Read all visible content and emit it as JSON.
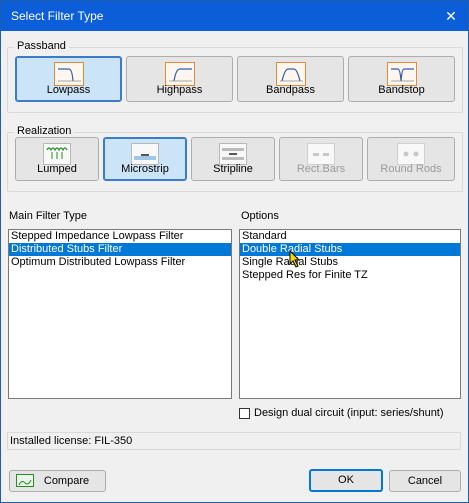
{
  "window": {
    "title": "Select Filter Type",
    "close_glyph": "✕"
  },
  "passband": {
    "label": "Passband",
    "buttons": [
      {
        "label": "Lowpass",
        "icon": "lowpass-response-icon",
        "selected": true
      },
      {
        "label": "Highpass",
        "icon": "highpass-response-icon",
        "selected": false
      },
      {
        "label": "Bandpass",
        "icon": "bandpass-response-icon",
        "selected": false
      },
      {
        "label": "Bandstop",
        "icon": "bandstop-response-icon",
        "selected": false
      }
    ]
  },
  "realization": {
    "label": "Realization",
    "buttons": [
      {
        "label": "Lumped",
        "icon": "lumped-icon",
        "selected": false,
        "enabled": true
      },
      {
        "label": "Microstrip",
        "icon": "microstrip-icon",
        "selected": true,
        "enabled": true
      },
      {
        "label": "Stripline",
        "icon": "stripline-icon",
        "selected": false,
        "enabled": true
      },
      {
        "label": "Rect.Bars",
        "icon": "rect-bars-icon",
        "selected": false,
        "enabled": false
      },
      {
        "label": "Round Rods",
        "icon": "round-rods-icon",
        "selected": false,
        "enabled": false
      }
    ]
  },
  "main_filter_type": {
    "label": "Main Filter Type",
    "items": [
      {
        "text": "Stepped Impedance Lowpass Filter",
        "selected": false
      },
      {
        "text": "Distributed Stubs Filter",
        "selected": true
      },
      {
        "text": "Optimum Distributed Lowpass Filter",
        "selected": false
      }
    ]
  },
  "options": {
    "label": "Options",
    "items": [
      {
        "text": "Standard",
        "selected": false
      },
      {
        "text": "Double Radial Stubs",
        "selected": true
      },
      {
        "text": "Single Radial Stubs",
        "selected": false
      },
      {
        "text": "Stepped Res for Finite TZ",
        "selected": false
      }
    ]
  },
  "design_dual": {
    "label": "Design dual circuit (input: series/shunt)",
    "checked": false
  },
  "license": {
    "text": "Installed license:  FIL-350"
  },
  "footer": {
    "compare": "Compare",
    "ok": "OK",
    "cancel": "Cancel"
  },
  "colors": {
    "title_bar": "#0b5ed7",
    "selection": "#0078d7",
    "selected_button": "#cce4f7"
  }
}
